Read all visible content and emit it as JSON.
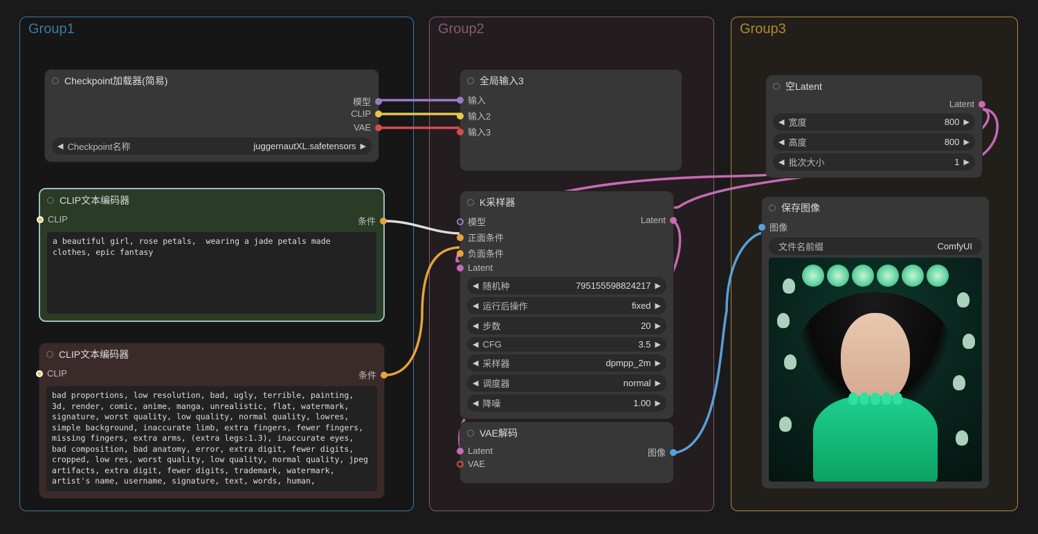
{
  "groups": {
    "g1": {
      "title": "Group1",
      "color": "#3a7aaa"
    },
    "g2": {
      "title": "Group2",
      "color": "#8a5a70"
    },
    "g3": {
      "title": "Group3",
      "color": "#b08a30"
    }
  },
  "checkpoint": {
    "title": "Checkpoint加载器(简易)",
    "ports": {
      "model": "模型",
      "clip": "CLIP",
      "vae": "VAE"
    },
    "widget": {
      "label": "Checkpoint名称",
      "value": "juggernautXL.safetensors"
    }
  },
  "clip_pos": {
    "title": "CLIP文本编码器",
    "in": "CLIP",
    "out": "条件",
    "text": "a beautiful girl, rose petals,  wearing a jade petals made clothes, epic fantasy"
  },
  "clip_neg": {
    "title": "CLIP文本编码器",
    "in": "CLIP",
    "out": "条件",
    "text": "bad proportions, low resolution, bad, ugly, terrible, painting, 3d, render, comic, anime, manga, unrealistic, flat, watermark, signature, worst quality, low quality, normal quality, lowres, simple background, inaccurate limb, extra fingers, fewer fingers, missing fingers, extra arms, (extra legs:1.3), inaccurate eyes, bad composition, bad anatomy, error, extra digit, fewer digits, cropped, low res, worst quality, low quality, normal quality, jpeg artifacts, extra digit, fewer digits, trademark, watermark, artist's name, username, signature, text, words, human,"
  },
  "reroute": {
    "title": "全局输入3",
    "p1": "输入",
    "p2": "输入2",
    "p3": "输入3"
  },
  "ksampler": {
    "title": "K采样器",
    "in": {
      "model": "模型",
      "pos": "正面条件",
      "neg": "负面条件",
      "latent": "Latent"
    },
    "out": "Latent",
    "widgets": {
      "seed": {
        "label": "随机种",
        "value": "795155598824217"
      },
      "after": {
        "label": "运行后操作",
        "value": "fixed"
      },
      "steps": {
        "label": "步数",
        "value": "20"
      },
      "cfg": {
        "label": "CFG",
        "value": "3.5"
      },
      "sampler": {
        "label": "采样器",
        "value": "dpmpp_2m"
      },
      "scheduler": {
        "label": "调度器",
        "value": "normal"
      },
      "denoise": {
        "label": "降噪",
        "value": "1.00"
      }
    }
  },
  "vae_decode": {
    "title": "VAE解码",
    "in": {
      "latent": "Latent",
      "vae": "VAE"
    },
    "out": "图像"
  },
  "empty_latent": {
    "title": "空Latent",
    "out": "Latent",
    "widgets": {
      "width": {
        "label": "宽度",
        "value": "800"
      },
      "height": {
        "label": "高度",
        "value": "800"
      },
      "batch": {
        "label": "批次大小",
        "value": "1"
      }
    }
  },
  "save": {
    "title": "保存图像",
    "in": "图像",
    "widget": {
      "label": "文件名前缀",
      "value": "ComfyUI"
    }
  },
  "colors": {
    "model": "#9b7bc7",
    "clip": "#e6c74a",
    "vae": "#d94c4c",
    "cond": "#e8a33d",
    "latent": "#c76bb3",
    "image": "#5aa0d8",
    "white": "#dddddd"
  }
}
